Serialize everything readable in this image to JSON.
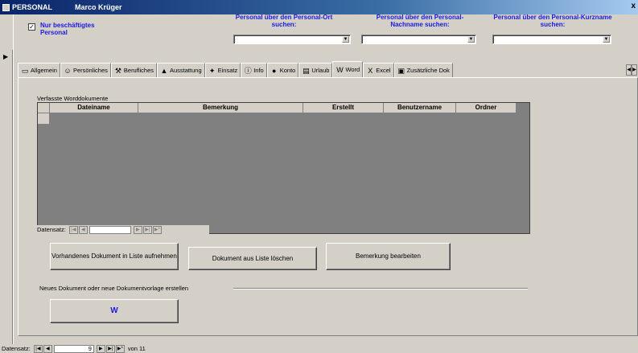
{
  "window": {
    "title": "PERSONAL",
    "user": "Marco Krüger",
    "close_glyph": "x"
  },
  "header": {
    "checkbox_label": "Nur beschäftigtes Personal",
    "checkbox_checked": true,
    "search_ort_label": "Personal über den Personal-Ort suchen:",
    "search_nachname_label": "Personal über den Personal-Nachname suchen:",
    "search_kurzname_label": "Personal über den Personal-Kurzname suchen:"
  },
  "tabs": [
    {
      "label": "Allgemein",
      "icon": "card-icon",
      "glyph": "▭"
    },
    {
      "label": "Persönliches",
      "icon": "people-icon",
      "glyph": "☺"
    },
    {
      "label": "Berufliches",
      "icon": "tools-icon",
      "glyph": "⚒"
    },
    {
      "label": "Ausstattung",
      "icon": "equipment-icon",
      "glyph": "▲"
    },
    {
      "label": "Einsatz",
      "icon": "deployment-icon",
      "glyph": "✦"
    },
    {
      "label": "Info",
      "icon": "info-icon",
      "glyph": "ⓘ"
    },
    {
      "label": "Konto",
      "icon": "account-icon",
      "glyph": "●"
    },
    {
      "label": "Urlaub",
      "icon": "calendar-icon",
      "glyph": "▤"
    },
    {
      "label": "Word",
      "icon": "word-icon",
      "glyph": "W",
      "active": true
    },
    {
      "label": "Excel",
      "icon": "excel-icon",
      "glyph": "X"
    },
    {
      "label": "Zusätzliche Dok",
      "icon": "document-icon",
      "glyph": "▣"
    }
  ],
  "word_tab": {
    "group_caption": "Verfasste Worddokumente",
    "columns": [
      "Dateiname",
      "Bemerkung",
      "Erstellt",
      "Benutzername",
      "Ordner"
    ],
    "sub_nav_label": "Datensatz:",
    "btn_add": "Vorhandenes Dokument in Liste aufnehmen",
    "btn_remove": "Dokument aus Liste löschen",
    "btn_edit": "Bemerkung bearbeiten",
    "new_caption": "Neues Dokument oder neue Dokumentvorlage erstellen"
  },
  "record_nav": {
    "label": "Datensatz:",
    "current": "9",
    "of_label": "von 11"
  },
  "colors": {
    "title_start": "#0a246a",
    "label_blue": "#1a1ae0",
    "face": "#d4d0c8"
  }
}
